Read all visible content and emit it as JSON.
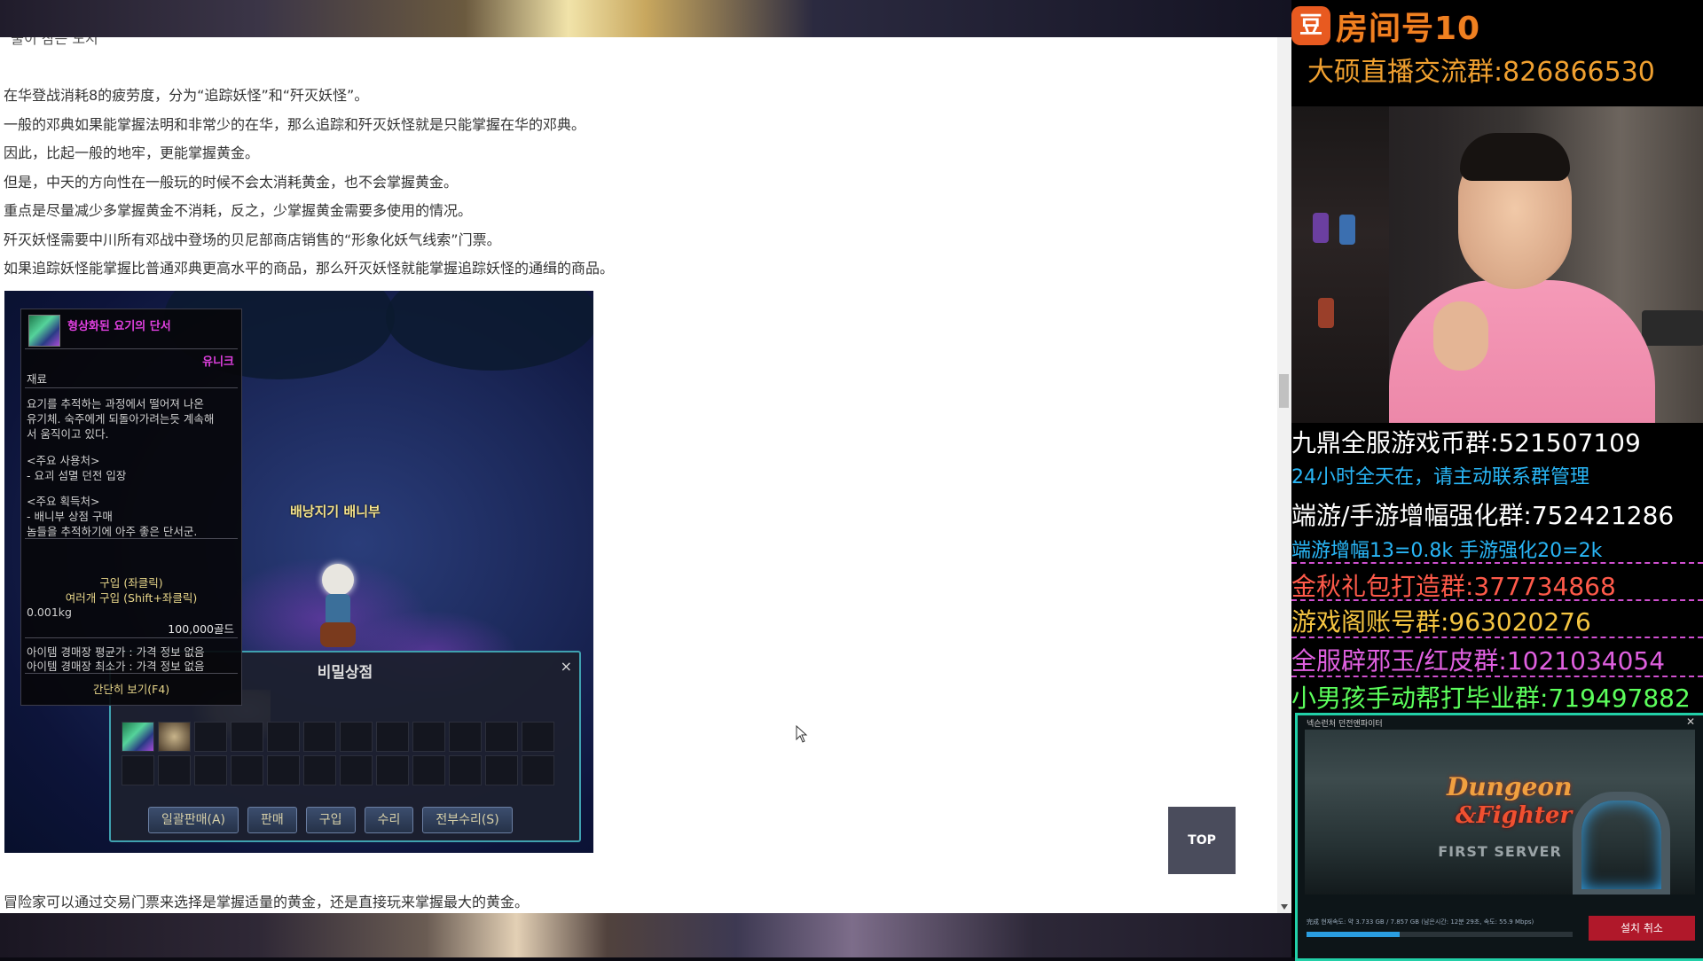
{
  "article": {
    "cut_line": "“물이 잠든 도시”",
    "paragraphs": [
      "在华登战消耗8的疲劳度，分为“追踪妖怪”和“歼灭妖怪”。",
      "一般的邓典如果能掌握法明和非常少的在华，那么追踪和歼灭妖怪就是只能掌握在华的邓典。",
      "因此，比起一般的地牢，更能掌握黄金。",
      "但是，中天的方向性在一般玩的时候不会太消耗黄金，也不会掌握黄金。",
      "重点是尽量减少多掌握黄金不消耗，反之，少掌握黄金需要多使用的情况。",
      "歼灭妖怪需要中川所有邓战中登场的贝尼部商店销售的“形象化妖气线索”门票。",
      "如果追踪妖怪能掌握比普通邓典更高水平的商品，那么歼灭妖怪就能掌握追踪妖怪的通缉的商品。"
    ],
    "after_image": "冒险家可以通过交易门票来选择是掌握适量的黄金，还是直接玩来掌握最大的黄金。",
    "top_button": "TOP"
  },
  "game": {
    "tooltip": {
      "item_name": "형상화된 요기의 단서",
      "rarity": "유니크",
      "type": "재료",
      "desc": [
        "요기를 추적하는 과정에서 떨어져 나온",
        "유기체. 숙주에게 되돌아가려는듯 계속해",
        "서 움직이고 있다."
      ],
      "use_header": "<주요 사용처>",
      "use_value": "- 요괴 섬멸 던전 입장",
      "get_header": "<주요 획득처>",
      "get_value": "- 배니부 상점 구매",
      "flavor": "놈들을 추적하기에 아주 좋은 단서군.",
      "buy": "구입 (좌클릭)",
      "buy_multi": "여러개 구입 (Shift+좌클릭)",
      "weight": "0.001kg",
      "price": "100,000골드",
      "auction_avg": "아이템 경매장 평균가 :  가격 정보 없음",
      "auction_min": "아이템 경매장 최소가 :  가격 정보 없음",
      "simple_view": "간단히 보기(F4)"
    },
    "npc_name": "배낭지기 배니부",
    "shop": {
      "title": "비밀상점",
      "close": "×",
      "buttons": [
        "일괄판매(A)",
        "판매",
        "구입",
        "수리",
        "전부수리(S)"
      ]
    }
  },
  "sidebar": {
    "logo_char": "豆",
    "room": "房间号10",
    "stream_group": "大硕直播交流群:826866530",
    "lines": [
      {
        "text": "九鼎全服游戏币群:521507109",
        "color": "#ffffff"
      },
      {
        "text": "24小时全天在，请主动联系群管理",
        "color": "#29b6f6"
      },
      {
        "text": "端游/手游增幅强化群:752421286",
        "color": "#ffffff"
      },
      {
        "text": "端游增幅13=0.8k 手游强化20=2k",
        "color": "#29b6f6"
      },
      {
        "text": "金秋礼包打造群:377734868",
        "color": "#ff5a4a"
      },
      {
        "text": "游戏阁账号群:963020276",
        "color": "#f5c542"
      },
      {
        "text": "全服辟邪玉/红皮群:1021034054",
        "color": "#e060e0"
      },
      {
        "text": "小男孩手动帮打毕业群:719497882",
        "color": "#5cff5c"
      }
    ],
    "launcher": {
      "title": "넥슨런처 던전앤파이터",
      "close": "✕",
      "logo_line1": "Dungeon",
      "logo_line2": "&Fighter",
      "server": "FIRST SERVER",
      "status": "完成 현재속도: 약 3.733 GB / 7.857 GB (남은시간: 12분 29초, 속도: 55.9 Mbps)",
      "progress": 0.35,
      "cancel": "설치 취소"
    }
  }
}
